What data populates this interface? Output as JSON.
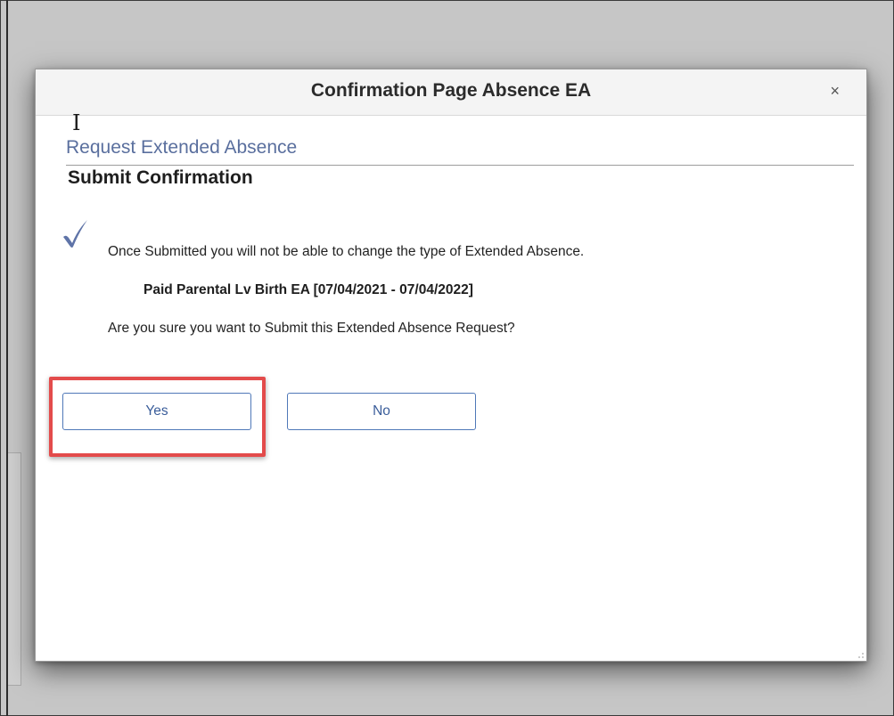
{
  "dialog": {
    "title": "Confirmation Page Absence EA",
    "close_label": "×"
  },
  "section": {
    "title": "Request Extended Absence",
    "subtitle": "Submit Confirmation"
  },
  "message": {
    "icon": "checkmark-icon",
    "line1": "Once Submitted you will not be able to change the type of Extended Absence.",
    "absence": "Paid Parental Lv Birth EA [07/04/2021 - 07/04/2022]",
    "question": "Are you sure you want to Submit this Extended Absence Request?"
  },
  "buttons": {
    "yes": "Yes",
    "no": "No"
  },
  "colors": {
    "accent": "#5a6f9e",
    "button_border": "#4f78b8",
    "highlight": "#e34b4b",
    "backdrop": "#c6c6c6"
  }
}
